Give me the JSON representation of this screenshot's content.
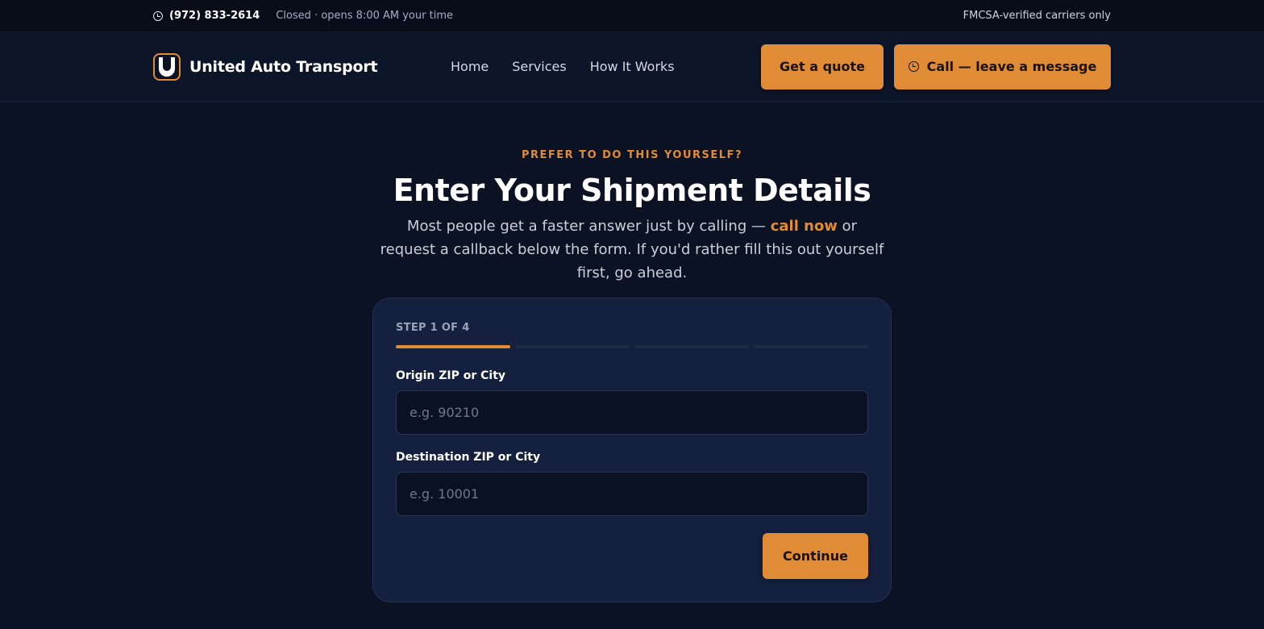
{
  "topbar": {
    "phone": "(972) 833-2614",
    "hours": "Closed · opens 8:00 AM your time",
    "badge": "FMCSA-verified carriers only",
    "icon": "phone-icon"
  },
  "header": {
    "brand_name": "United Auto Transport",
    "logo_letter": "U",
    "nav": [
      "Home",
      "Services",
      "How It Works"
    ],
    "quote_label": "Get a quote",
    "call_label": "Call — leave a message"
  },
  "hero": {
    "eyebrow": "PREFER TO DO THIS YOURSELF?",
    "title": "Enter Your Shipment Details",
    "intro_before": "Most people get a faster answer just by calling — ",
    "intro_link": "call now",
    "intro_after": " or request a callback below the form. If you'd rather fill this out yourself first, go ahead."
  },
  "form": {
    "step": "STEP 1 OF 4",
    "progress": {
      "current": 1,
      "total": 4
    },
    "origin": {
      "label": "Origin ZIP or City",
      "placeholder": "e.g. 90210",
      "value": ""
    },
    "destination": {
      "label": "Destination ZIP or City",
      "placeholder": "e.g. 10001",
      "value": ""
    },
    "continue_label": "Continue"
  },
  "colors": {
    "accent": "#e08b36",
    "background": "#0b1224",
    "card": "#14203d"
  }
}
